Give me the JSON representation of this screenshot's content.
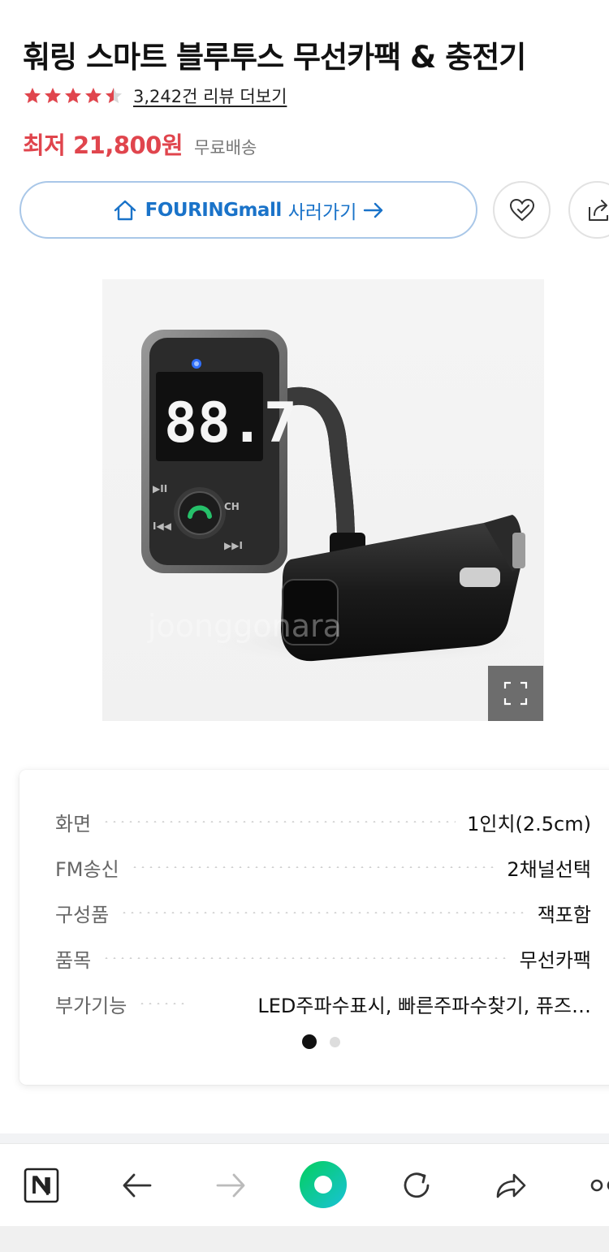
{
  "product": {
    "title": "훠링 스마트 블루투스 무선카팩 & 충전기",
    "rating": 4.5,
    "review_link": "3,242건 리뷰 더보기",
    "price": "최저 21,800원",
    "shipping": "무료배송"
  },
  "buy_button": {
    "mall": "FOURINGmall",
    "action": "사러가기"
  },
  "image": {
    "watermark": "joonggonara"
  },
  "specs": [
    {
      "label": "화면",
      "value": "1인치(2.5cm)"
    },
    {
      "label": "FM송신",
      "value": "2채널선택"
    },
    {
      "label": "구성품",
      "value": "잭포함"
    },
    {
      "label": "품목",
      "value": "무선카팩"
    },
    {
      "label": "부가기능",
      "value": "LED주파수표시, 빠른주파수찾기, 퓨즈…"
    }
  ],
  "pager": {
    "count": 2,
    "active": 0
  },
  "device_display": "88.7",
  "colors": {
    "accent_red": "#e0454d",
    "link_blue": "#1a73c9",
    "naver_green": "#03cf5d"
  },
  "bottom_nav": {
    "icons": [
      "naver-n-icon",
      "back-arrow-icon",
      "forward-arrow-icon",
      "naver-home-icon",
      "reload-icon",
      "share-icon",
      "more-icon"
    ]
  }
}
